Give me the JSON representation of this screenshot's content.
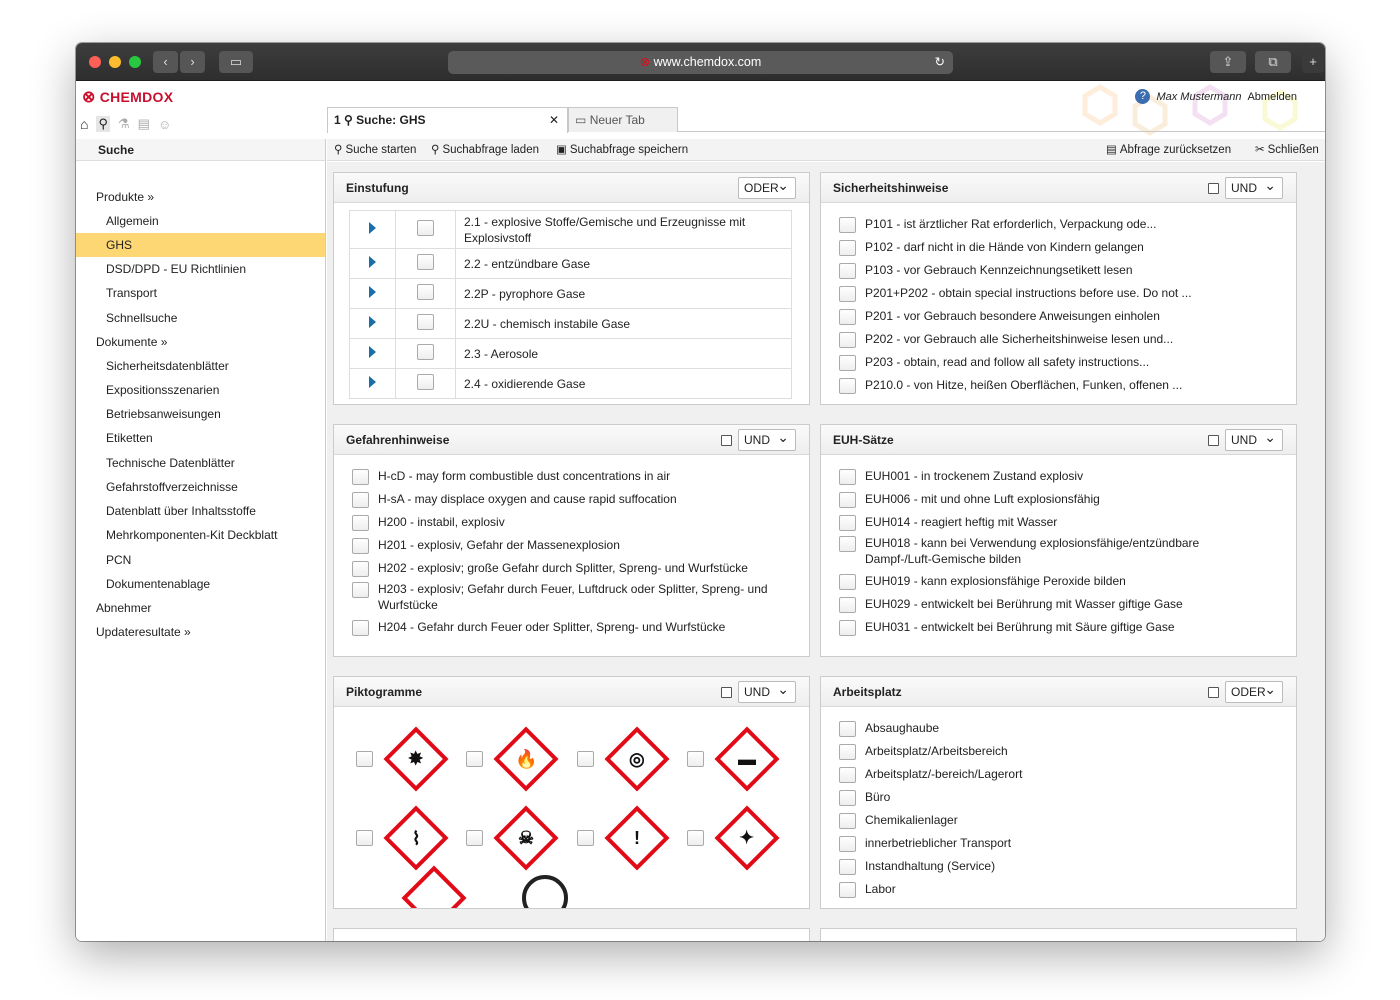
{
  "browser": {
    "url": "www.chemdox.com"
  },
  "app": {
    "logo": "CHEMDOX",
    "user": "Max Mustermann",
    "logout": "Abmelden"
  },
  "sidebar": {
    "title": "Suche",
    "items": [
      {
        "label": "Produkte »",
        "level": "sec"
      },
      {
        "label": "Allgemein",
        "level": "sub"
      },
      {
        "label": "GHS",
        "level": "sub",
        "active": true
      },
      {
        "label": "DSD/DPD - EU Richtlinien",
        "level": "sub"
      },
      {
        "label": "Transport",
        "level": "sub"
      },
      {
        "label": "Schnellsuche",
        "level": "sub"
      },
      {
        "label": "Dokumente »",
        "level": "sec"
      },
      {
        "label": "Sicherheitsdatenblätter",
        "level": "sub"
      },
      {
        "label": "Expositionsszenarien",
        "level": "sub"
      },
      {
        "label": "Betriebsanweisungen",
        "level": "sub"
      },
      {
        "label": "Etiketten",
        "level": "sub"
      },
      {
        "label": "Technische Datenblätter",
        "level": "sub"
      },
      {
        "label": "Gefahrstoffverzeichnisse",
        "level": "sub"
      },
      {
        "label": "Datenblatt über Inhaltsstoffe",
        "level": "sub"
      },
      {
        "label": "Mehrkomponenten-Kit Deckblatt",
        "level": "sub"
      },
      {
        "label": "PCN",
        "level": "sub"
      },
      {
        "label": "Dokumentenablage",
        "level": "sub"
      },
      {
        "label": "Abnehmer",
        "level": "sec"
      },
      {
        "label": "Updateresultate »",
        "level": "sec"
      }
    ]
  },
  "tabs": {
    "active_number": "1",
    "active_label": "Suche: GHS",
    "close": "✕",
    "new_tab": "Neuer Tab"
  },
  "toolbar": {
    "start": "Suche starten",
    "load": "Suchabfrage laden",
    "save": "Suchabfrage speichern",
    "reset": "Abfrage zurücksetzen",
    "close": "Schließen"
  },
  "panels": {
    "einstufung": {
      "title": "Einstufung",
      "op": "ODER",
      "rows": [
        "2.1 - explosive Stoffe/Gemische und Erzeugnisse mit Explosivstoff",
        "2.2 - entzündbare Gase",
        "2.2P - pyrophore Gase",
        "2.2U - chemisch instabile Gase",
        "2.3 - Aerosole",
        "2.4 - oxidierende Gase"
      ]
    },
    "sicherheit": {
      "title": "Sicherheitshinweise",
      "op": "UND",
      "rows": [
        "P101 - ist ärztlicher Rat erforderlich, Verpackung ode...",
        "P102 - darf nicht in die Hände von Kindern gelangen",
        "P103 - vor Gebrauch Kennzeichnungsetikett lesen",
        "P201+P202 - obtain special instructions before use. Do not ...",
        "P201 - vor Gebrauch besondere Anweisungen einholen",
        "P202 - vor Gebrauch alle Sicherheitshinweise lesen und...",
        "P203 - obtain, read and follow all safety instructions...",
        "P210.0 - von Hitze, heißen Oberflächen, Funken, offenen ..."
      ]
    },
    "gefahren": {
      "title": "Gefahrenhinweise",
      "op": "UND",
      "rows": [
        "H-cD - may form combustible dust concentrations in air",
        "H-sA - may displace oxygen and cause rapid suffocation",
        "H200 - instabil, explosiv",
        "H201 - explosiv, Gefahr der Massenexplosion",
        "H202 - explosiv; große Gefahr durch Splitter, Spreng- und Wurfstücke",
        "H203 - explosiv; Gefahr durch Feuer, Luftdruck oder Splitter, Spreng- und Wurfstücke",
        "H204 - Gefahr durch Feuer oder Splitter, Spreng- und Wurfstücke"
      ]
    },
    "euh": {
      "title": "EUH-Sätze",
      "op": "UND",
      "rows": [
        "EUH001 - in trockenem Zustand explosiv",
        "EUH006 - mit und ohne Luft explosionsfähig",
        "EUH014 - reagiert heftig mit Wasser",
        "EUH018 - kann bei Verwendung explosionsfähige/entzündbare Dampf-/Luft-Gemische bilden",
        "EUH019 - kann explosionsfähige Peroxide bilden",
        "EUH029 - entwickelt bei Berührung mit Wasser giftige Gase",
        "EUH031 - entwickelt bei Berührung mit Säure giftige Gase"
      ]
    },
    "pikto": {
      "title": "Piktogramme",
      "op": "UND",
      "symbols": [
        "explosive-bomb-icon",
        "flame-icon",
        "flame-over-circle-icon",
        "gas-cylinder-icon",
        "corrosion-icon",
        "skull-crossbones-icon",
        "exclamation-icon",
        "health-hazard-icon"
      ],
      "glyphs": [
        "✸",
        "🔥",
        "◎",
        "▬",
        "⌇",
        "☠",
        "!",
        "✦"
      ]
    },
    "arbeitsplatz": {
      "title": "Arbeitsplatz",
      "op": "ODER",
      "rows": [
        "Absaughaube",
        "Arbeitsplatz/Arbeitsbereich",
        "Arbeitsplatz/-bereich/Lagerort",
        "Büro",
        "Chemikalienlager",
        "innerbetrieblicher Transport",
        "Instandhaltung (Service)",
        "Labor"
      ]
    }
  }
}
